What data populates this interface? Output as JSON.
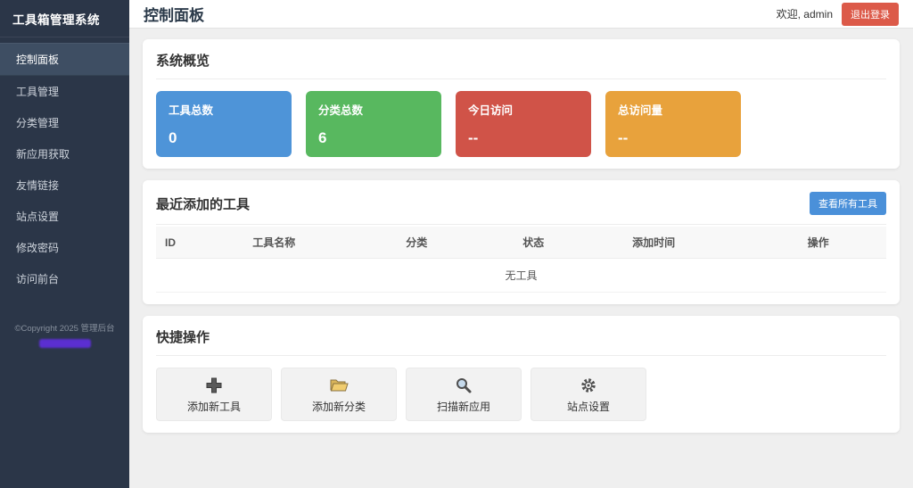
{
  "sidebar": {
    "title": "工具箱管理系统",
    "items": [
      {
        "label": "控制面板",
        "active": true
      },
      {
        "label": "工具管理",
        "active": false
      },
      {
        "label": "分类管理",
        "active": false
      },
      {
        "label": "新应用获取",
        "active": false
      },
      {
        "label": "友情链接",
        "active": false
      },
      {
        "label": "站点设置",
        "active": false
      },
      {
        "label": "修改密码",
        "active": false
      },
      {
        "label": "访问前台",
        "active": false
      }
    ],
    "footer_copyright": "©Copyright 2025 管理后台"
  },
  "header": {
    "title": "控制面板",
    "welcome": "欢迎, admin",
    "logout_label": "退出登录"
  },
  "overview": {
    "title": "系统概览",
    "stats": [
      {
        "label": "工具总数",
        "value": "0",
        "color": "#4e94d8"
      },
      {
        "label": "分类总数",
        "value": "6",
        "color": "#58b85f"
      },
      {
        "label": "今日访问",
        "value": "--",
        "color": "#d05348"
      },
      {
        "label": "总访问量",
        "value": "--",
        "color": "#e8a23c"
      }
    ]
  },
  "recent_tools": {
    "title": "最近添加的工具",
    "view_all_label": "查看所有工具",
    "columns": [
      "ID",
      "工具名称",
      "分类",
      "状态",
      "添加时间",
      "操作"
    ],
    "empty_message": "无工具"
  },
  "quick_actions": {
    "title": "快捷操作",
    "actions": [
      {
        "label": "添加新工具"
      },
      {
        "label": "添加新分类"
      },
      {
        "label": "扫描新应用"
      },
      {
        "label": "站点设置"
      }
    ]
  },
  "colors": {
    "sidebar_bg": "#2b3648",
    "logout_button": "#dc5a49",
    "view_all_button": "#4a90d9",
    "footer_link": "#5b2fd1"
  }
}
